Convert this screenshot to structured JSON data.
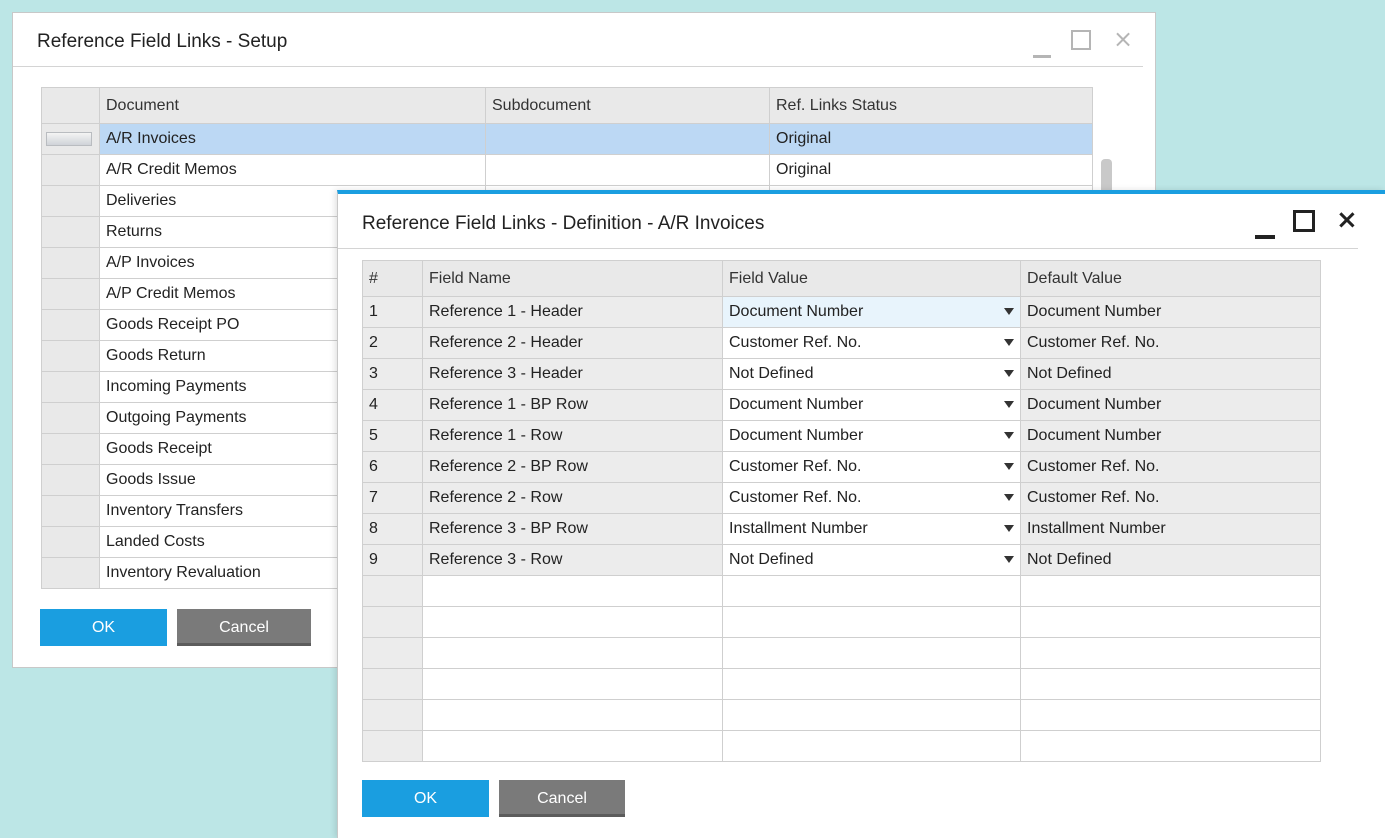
{
  "setup_window": {
    "title": "Reference Field Links - Setup",
    "columns": [
      "Document",
      "Subdocument",
      "Ref. Links Status"
    ],
    "rows": [
      {
        "document": "A/R Invoices",
        "subdocument": "",
        "status": "Original",
        "selected": true
      },
      {
        "document": "A/R Credit Memos",
        "subdocument": "",
        "status": "Original"
      },
      {
        "document": "Deliveries"
      },
      {
        "document": "Returns"
      },
      {
        "document": "A/P Invoices"
      },
      {
        "document": "A/P Credit Memos"
      },
      {
        "document": "Goods Receipt PO"
      },
      {
        "document": "Goods Return"
      },
      {
        "document": "Incoming Payments"
      },
      {
        "document": "Outgoing Payments"
      },
      {
        "document": "Goods Receipt"
      },
      {
        "document": "Goods Issue"
      },
      {
        "document": "Inventory Transfers"
      },
      {
        "document": "Landed Costs"
      },
      {
        "document": "Inventory Revaluation"
      }
    ],
    "ok_label": "OK",
    "cancel_label": "Cancel"
  },
  "definition_window": {
    "title": "Reference Field Links - Definition - A/R Invoices",
    "columns": [
      "#",
      "Field Name",
      "Field Value",
      "Default Value"
    ],
    "rows": [
      {
        "num": "1",
        "field_name": "Reference 1 - Header",
        "field_value": "Document Number",
        "default_value": "Document Number"
      },
      {
        "num": "2",
        "field_name": "Reference 2 - Header",
        "field_value": "Customer Ref. No.",
        "default_value": "Customer Ref. No."
      },
      {
        "num": "3",
        "field_name": "Reference 3 - Header",
        "field_value": "Not Defined",
        "default_value": "Not Defined"
      },
      {
        "num": "4",
        "field_name": "Reference 1 - BP Row",
        "field_value": "Document Number",
        "default_value": "Document Number"
      },
      {
        "num": "5",
        "field_name": "Reference 1 - Row",
        "field_value": "Document Number",
        "default_value": "Document Number"
      },
      {
        "num": "6",
        "field_name": "Reference 2 - BP Row",
        "field_value": "Customer Ref. No.",
        "default_value": "Customer Ref. No."
      },
      {
        "num": "7",
        "field_name": "Reference 2 - Row",
        "field_value": "Customer Ref. No.",
        "default_value": "Customer Ref. No."
      },
      {
        "num": "8",
        "field_name": "Reference 3 - BP Row",
        "field_value": "Installment Number",
        "default_value": "Installment Number"
      },
      {
        "num": "9",
        "field_name": "Reference 3 - Row",
        "field_value": "Not Defined",
        "default_value": "Not Defined"
      }
    ],
    "ok_label": "OK",
    "cancel_label": "Cancel"
  },
  "icons": {
    "close": "×",
    "minimize": "minimize-icon",
    "maximize": "maximize-icon",
    "dropdown": "dropdown-arrow-icon"
  },
  "colors": {
    "accent": "#1a9ee0",
    "selected_row": "#bcd8f4",
    "background": "#bce6e6",
    "cancel_button": "#7a7a7a"
  }
}
